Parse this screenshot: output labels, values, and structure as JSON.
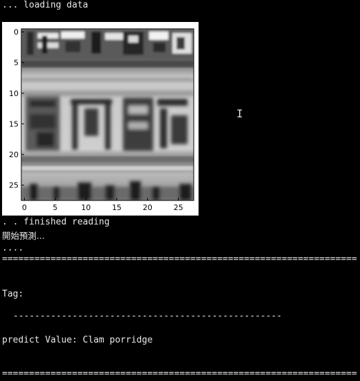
{
  "console": {
    "line_loading": "... loading data",
    "line_finished": ". . finished reading",
    "line_predict_start": "開始預測...",
    "line_dots": "....",
    "separator": "==================================================================",
    "tag_label": "Tag:",
    "dash_line": "--------------------------------------------------",
    "predict_line": "predict Value: Clam porridge"
  },
  "image_plot": {
    "x_ticks": [
      "0",
      "5",
      "10",
      "15",
      "20",
      "25"
    ],
    "y_ticks": [
      "0",
      "5",
      "10",
      "15",
      "20",
      "25"
    ],
    "image_text": "魯肉飯",
    "colormap": "grayscale"
  },
  "cursor": {
    "icon": "i-beam-cursor-icon",
    "glyph": "I"
  }
}
